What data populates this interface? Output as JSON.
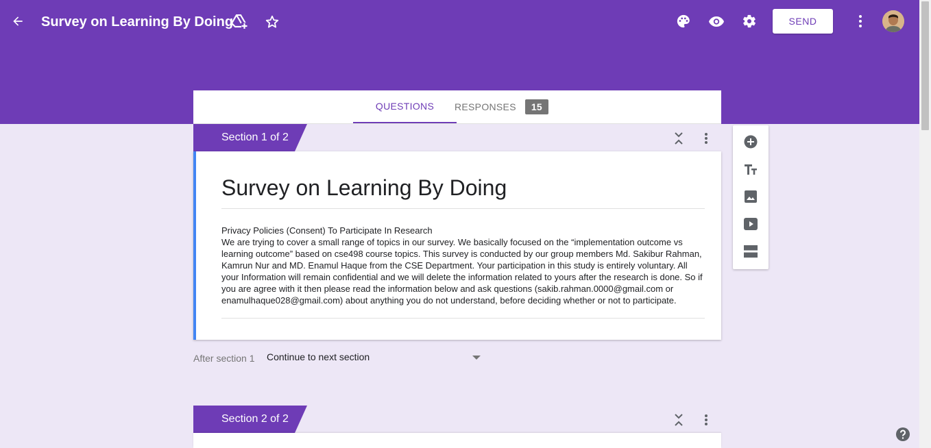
{
  "header": {
    "title": "Survey on Learning By Doing",
    "send_label": "SEND",
    "icons": [
      "back-arrow-icon",
      "drive-add-icon",
      "star-icon",
      "palette-icon",
      "eye-icon",
      "gear-icon",
      "more-vert-icon"
    ],
    "brand_color": "#6e3cb6"
  },
  "tabs": {
    "questions": "QUESTIONS",
    "responses": "RESPONSES",
    "responses_count": "15"
  },
  "section1": {
    "tag": "Section 1 of 2",
    "form_title": "Survey on Learning By Doing",
    "description_heading": "Privacy Policies (Consent) To Participate In Research",
    "description_body": "We are trying to cover a small range of topics in our survey. We basically focused on the “implementation outcome vs learning outcome” based on cse498 course topics. This survey is conducted by our group members Md. Sakibur Rahman, Kamrun Nur and  MD. Enamul Haque from the CSE Department. Your participation in this study is entirely voluntary. All your Information will remain confidential and we will delete the information related to yours after the research is done. So if you are agree with it then please read the information below and ask questions (sakib.rahman.0000@gmail.com or enamulhaque028@gmail.com) about anything you do not understand, before deciding whether or not to participate."
  },
  "after_section": {
    "label": "After section 1",
    "value": "Continue to next section"
  },
  "section2": {
    "tag": "Section 2 of 2"
  },
  "toolbox": {
    "icons": [
      "add-question-icon",
      "add-title-icon",
      "add-image-icon",
      "add-video-icon",
      "add-section-icon"
    ]
  }
}
